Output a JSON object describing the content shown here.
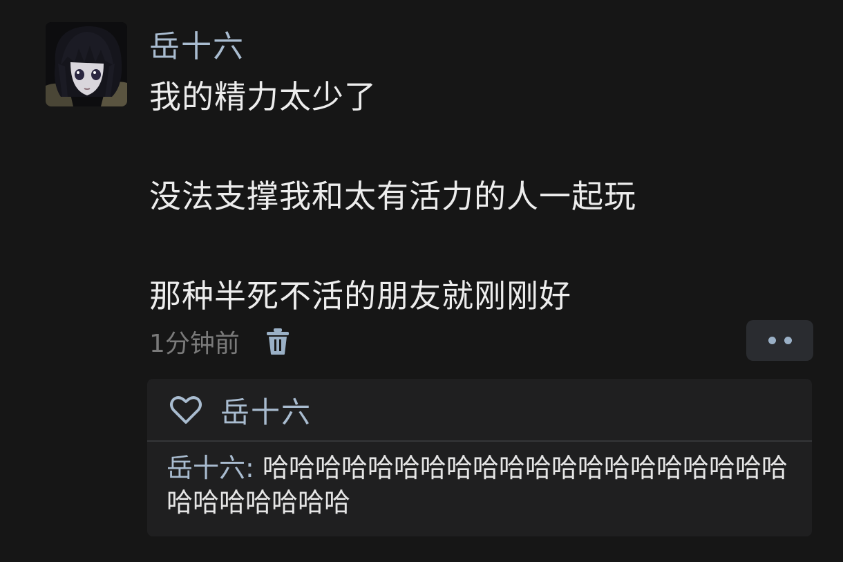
{
  "post": {
    "username": "岳十六",
    "lines": [
      "我的精力太少了",
      "没法支撑我和太有活力的人一起玩",
      "那种半死不活的朋友就刚刚好"
    ],
    "timestamp": "1分钟前"
  },
  "likes": {
    "names": "岳十六"
  },
  "comment": {
    "author": "岳十六:",
    "text": "哈哈哈哈哈哈哈哈哈哈哈哈哈哈哈哈哈哈哈哈哈哈哈哈哈哈哈"
  },
  "icons": {
    "avatar": "anime-avatar",
    "trash": "trash-icon",
    "more": "more-icon",
    "heart": "heart-icon"
  },
  "colors": {
    "background": "#161616",
    "name_blue": "#a9bcd0",
    "reply_box": "#1f1f20",
    "more_button": "#2a2c30"
  }
}
